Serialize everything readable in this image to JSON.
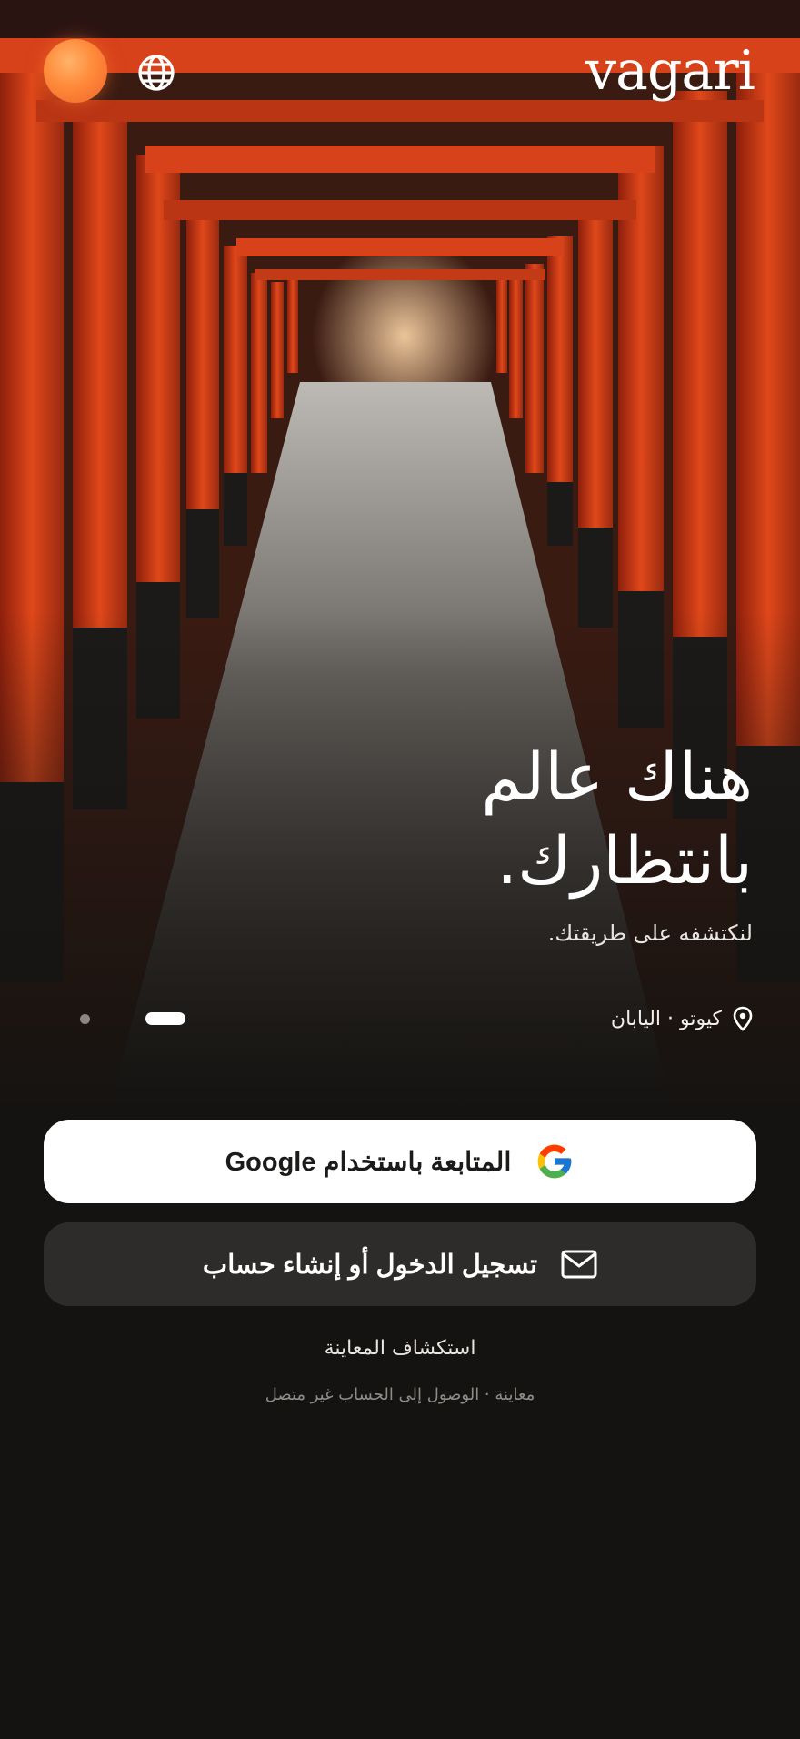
{
  "header": {
    "logo_text": "vagari",
    "theme_icon": "sun-orb-icon",
    "language_icon": "globe-icon"
  },
  "hero": {
    "headline_line1": "هناك عالم",
    "headline_line2": "بانتظارك.",
    "subtitle": "لنكتشفه على طريقتك.",
    "location": "كيوتو · اليابان",
    "location_icon": "map-pin-icon",
    "carousel": {
      "total": 2,
      "active_index": 1
    }
  },
  "actions": {
    "google_label": "المتابعة باستخدام Google",
    "email_label": "تسجيل الدخول أو إنشاء حساب",
    "explore_label": "استكشاف المعاينة",
    "footnote": "معاينة · الوصول إلى الحساب غير متصل"
  },
  "colors": {
    "background": "#151311",
    "accent_orange": "#f0642a",
    "secondary_button": "#2e2c2a"
  }
}
